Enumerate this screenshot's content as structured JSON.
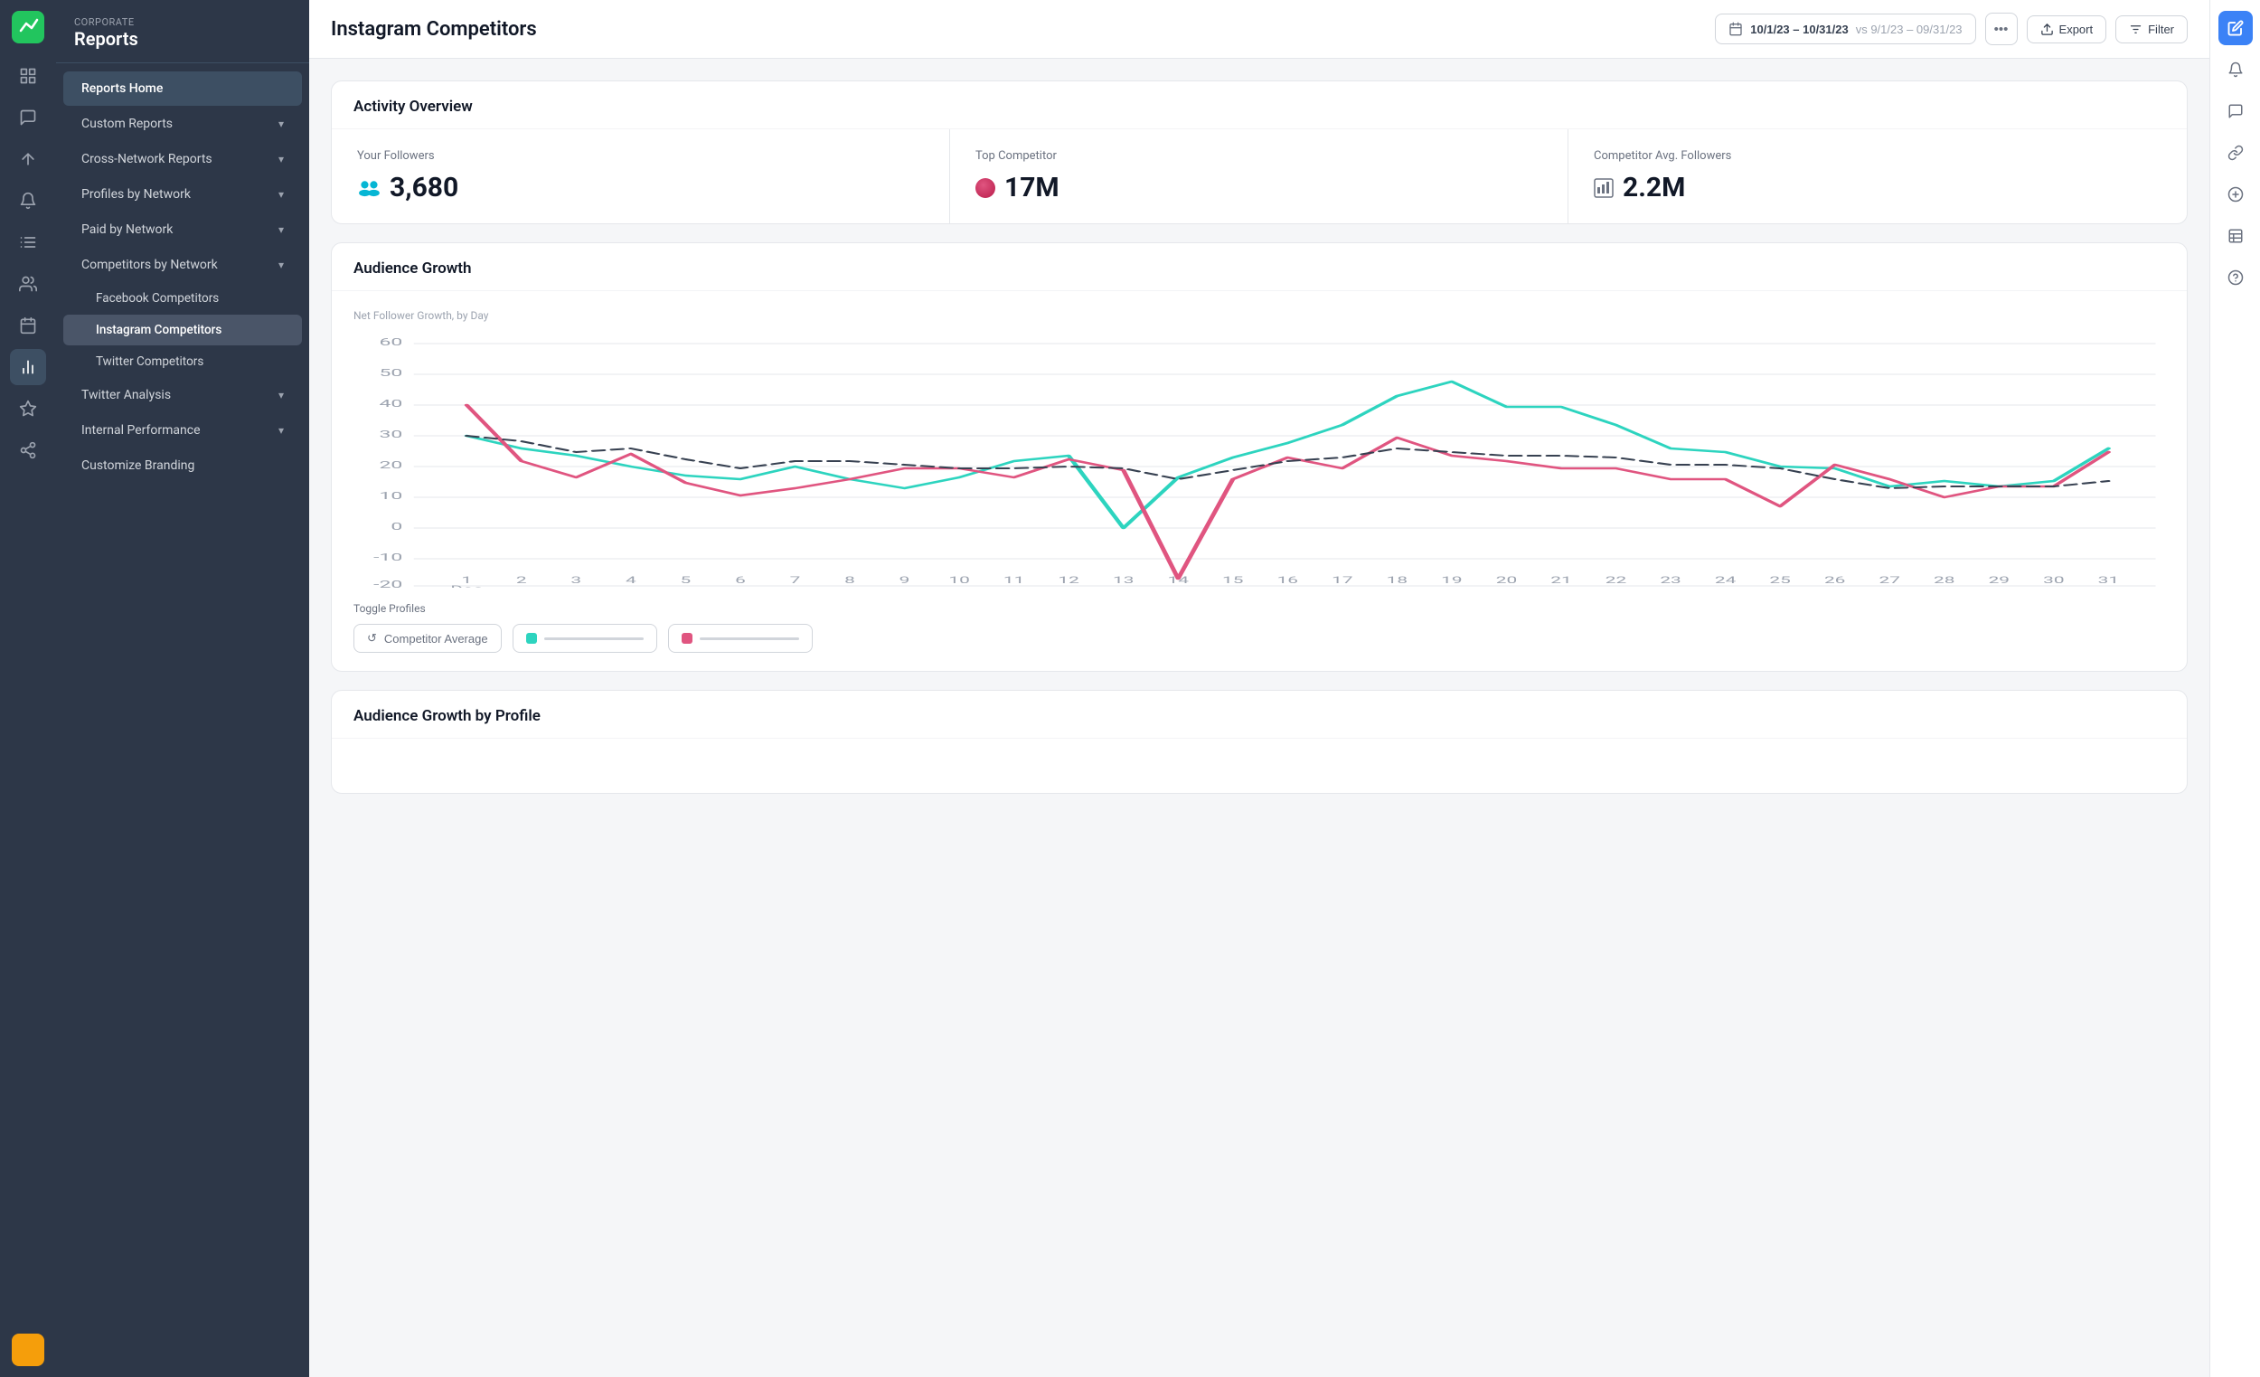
{
  "app": {
    "brand": "Corporate Reports",
    "brand_sub": "Corporate",
    "brand_main": "Reports"
  },
  "sidebar": {
    "items": [
      {
        "id": "reports-home",
        "label": "Reports Home",
        "active": true,
        "indent": 0
      },
      {
        "id": "custom-reports",
        "label": "Custom Reports",
        "expandable": true,
        "indent": 0
      },
      {
        "id": "cross-network",
        "label": "Cross-Network Reports",
        "expandable": true,
        "indent": 0
      },
      {
        "id": "profiles-by-network",
        "label": "Profiles by Network",
        "expandable": true,
        "indent": 0
      },
      {
        "id": "paid-by-network",
        "label": "Paid by Network",
        "expandable": true,
        "indent": 0
      },
      {
        "id": "competitors-by-network",
        "label": "Competitors by Network",
        "expandable": true,
        "expanded": true,
        "indent": 0
      },
      {
        "id": "facebook-competitors",
        "label": "Facebook Competitors",
        "indent": 1
      },
      {
        "id": "instagram-competitors",
        "label": "Instagram Competitors",
        "indent": 1,
        "selected": true
      },
      {
        "id": "twitter-competitors",
        "label": "Twitter Competitors",
        "indent": 1
      },
      {
        "id": "twitter-analysis",
        "label": "Twitter Analysis",
        "expandable": true,
        "indent": 0
      },
      {
        "id": "internal-performance",
        "label": "Internal Performance",
        "expandable": true,
        "indent": 0
      },
      {
        "id": "customize-branding",
        "label": "Customize Branding",
        "indent": 0
      }
    ]
  },
  "header": {
    "title": "Instagram Competitors",
    "date_main": "10/1/23 – 10/31/23",
    "date_vs": "vs 9/1/23 – 09/31/23",
    "export_label": "Export",
    "filter_label": "Filter"
  },
  "activity_overview": {
    "title": "Activity Overview",
    "cells": [
      {
        "id": "your-followers",
        "label": "Your Followers",
        "value": "3,680",
        "icon_type": "people"
      },
      {
        "id": "top-competitor",
        "label": "Top Competitor",
        "value": "17M",
        "icon_type": "dot-red"
      },
      {
        "id": "competitor-avg-followers",
        "label": "Competitor Avg. Followers",
        "value": "2.2M",
        "icon_type": "bar-chart-small"
      }
    ]
  },
  "audience_growth": {
    "title": "Audience Growth",
    "subtitle": "Net Follower Growth, by Day",
    "y_axis": [
      60,
      50,
      40,
      30,
      20,
      10,
      0,
      -10,
      -20
    ],
    "x_axis": [
      1,
      2,
      3,
      4,
      5,
      6,
      7,
      8,
      9,
      10,
      11,
      12,
      13,
      14,
      15,
      16,
      17,
      18,
      19,
      20,
      21,
      22,
      23,
      24,
      25,
      26,
      27,
      28,
      29,
      30,
      31
    ],
    "x_label": "Dec",
    "toggle_label": "Toggle Profiles",
    "toggles": [
      {
        "id": "competitor-avg",
        "label": "Competitor Average",
        "icon": "↺"
      },
      {
        "id": "teal-profile",
        "color": "#2dd4bf",
        "has_line": true
      },
      {
        "id": "red-profile",
        "color": "#e05580",
        "has_line": true
      }
    ]
  },
  "audience_growth_by_profile": {
    "title": "Audience Growth by Profile"
  },
  "colors": {
    "teal": "#2dd4bf",
    "pink": "#e05580",
    "dark_dashed": "#374151",
    "sidebar_bg": "#2d3748",
    "active_bg": "#3d4f63",
    "selected_bg": "#4a5568",
    "accent_blue": "#3b82f6"
  }
}
